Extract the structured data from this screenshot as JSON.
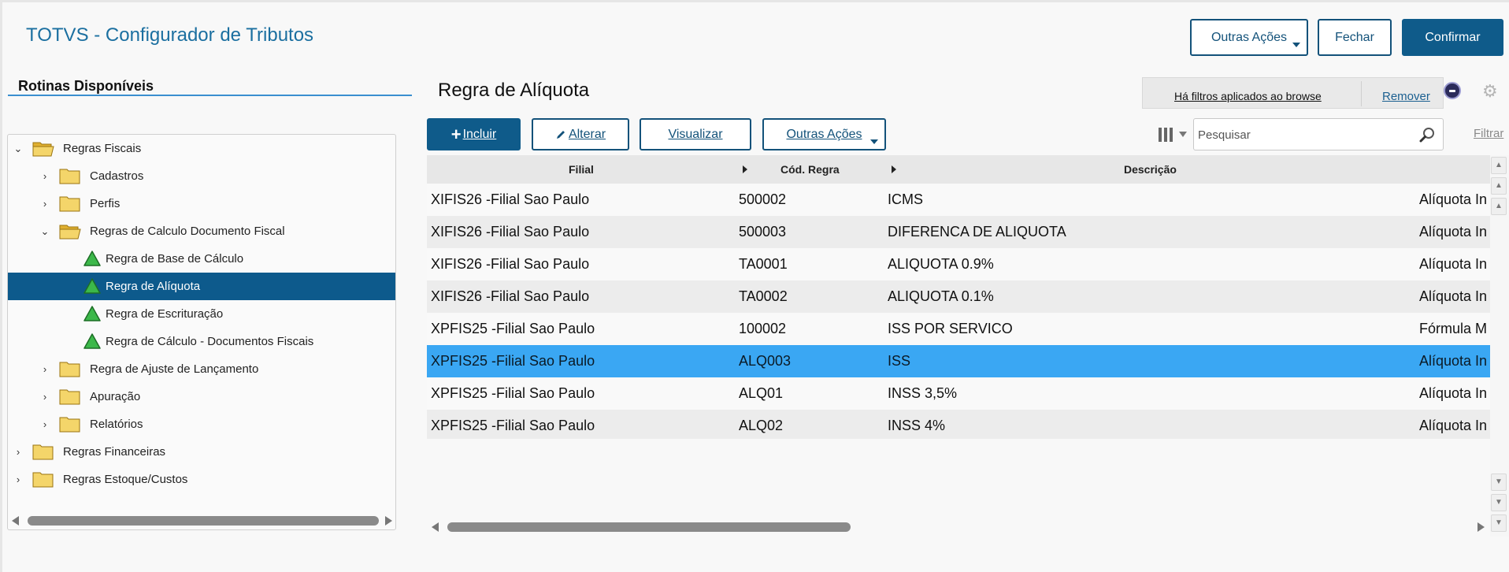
{
  "header": {
    "app_title": "TOTVS - Configurador de Tributos",
    "other_actions": "Outras Ações",
    "close": "Fechar",
    "confirm": "Confirmar"
  },
  "sidebar": {
    "title": "Rotinas Disponíveis",
    "nodes": [
      {
        "label": "Regras Fiscais"
      },
      {
        "label": "Cadastros"
      },
      {
        "label": "Perfis"
      },
      {
        "label": "Regras de Calculo Documento Fiscal"
      },
      {
        "label": "Regra de Base de Cálculo"
      },
      {
        "label": "Regra de Alíquota"
      },
      {
        "label": "Regra de Escrituração"
      },
      {
        "label": "Regra de Cálculo - Documentos Fiscais"
      },
      {
        "label": "Regra de Ajuste de Lançamento"
      },
      {
        "label": "Apuração"
      },
      {
        "label": "Relatórios"
      },
      {
        "label": "Regras Financeiras"
      },
      {
        "label": "Regras Estoque/Custos"
      }
    ]
  },
  "main": {
    "title": "Regra de Alíquota",
    "filter_notice": "Há filtros aplicados ao browse",
    "filter_remove": "Remover",
    "toolbar": {
      "include": "Incluir",
      "edit": "Alterar",
      "view": "Visualizar",
      "other_actions": "Outras Ações"
    },
    "search_placeholder": "Pesquisar",
    "filter_link": "Filtrar",
    "columns": [
      "Filial",
      "Cód. Regra",
      "Descrição"
    ],
    "rows": [
      {
        "filial": "XIFIS26 -Filial Sao Paulo",
        "codigo": "500002",
        "descricao": "ICMS",
        "tipo": "Alíquota In"
      },
      {
        "filial": "XIFIS26 -Filial Sao Paulo",
        "codigo": "500003",
        "descricao": "DIFERENCA DE ALIQUOTA",
        "tipo": "Alíquota In"
      },
      {
        "filial": "XIFIS26 -Filial Sao Paulo",
        "codigo": "TA0001",
        "descricao": "ALIQUOTA 0.9%",
        "tipo": "Alíquota In"
      },
      {
        "filial": "XIFIS26 -Filial Sao Paulo",
        "codigo": "TA0002",
        "descricao": "ALIQUOTA 0.1%",
        "tipo": "Alíquota In"
      },
      {
        "filial": "XPFIS25 -Filial Sao Paulo",
        "codigo": "100002",
        "descricao": "ISS POR SERVICO",
        "tipo": "Fórmula M"
      },
      {
        "filial": "XPFIS25 -Filial Sao Paulo",
        "codigo": "ALQ003",
        "descricao": "ISS",
        "tipo": "Alíquota In"
      },
      {
        "filial": "XPFIS25 -Filial Sao Paulo",
        "codigo": "ALQ01",
        "descricao": "INSS 3,5%",
        "tipo": "Alíquota In"
      },
      {
        "filial": "XPFIS25 -Filial Sao Paulo",
        "codigo": "ALQ02",
        "descricao": "INSS 4%",
        "tipo": "Alíquota In"
      }
    ]
  },
  "colors": {
    "brand": "#0f5b8a",
    "title_blue": "#1b6fa0",
    "selected_row": "#3aa7f3",
    "tree_selected": "#0d5a8c"
  }
}
